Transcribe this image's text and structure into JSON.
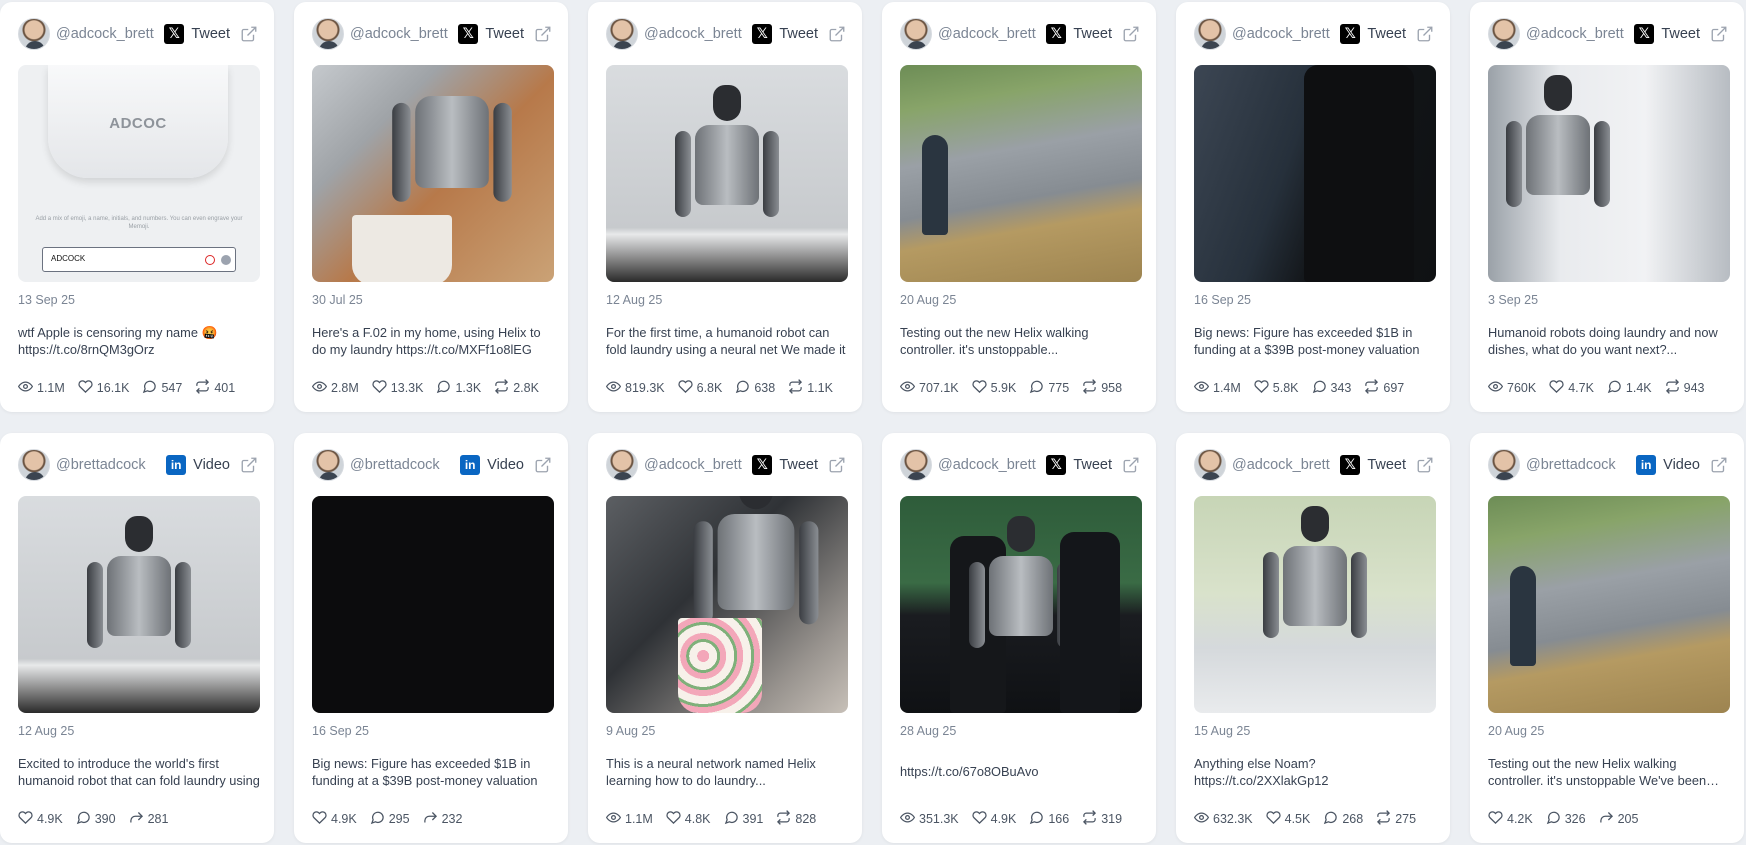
{
  "cards": [
    {
      "handle": "@adcock_brett",
      "platform": "x",
      "platform_label": "Tweet",
      "date": "13 Sep 25",
      "text": "wtf Apple is censoring my name 🤬 https://t.co/8rnQM3gOrz",
      "media": "airpods",
      "media_text": {
        "brand": "ADCOC",
        "hint": "Add a mix of emoji, a name, initials, and numbers. You can even engrave your Memoji.",
        "field": "ADCOCK"
      },
      "stats": [
        {
          "icon": "eye-icon",
          "value": "1.1M"
        },
        {
          "icon": "heart-icon",
          "value": "16.1K"
        },
        {
          "icon": "comment-icon",
          "value": "547"
        },
        {
          "icon": "retweet-icon",
          "value": "401"
        }
      ]
    },
    {
      "handle": "@adcock_brett",
      "platform": "x",
      "platform_label": "Tweet",
      "date": "30 Jul 25",
      "text": "Here's a F.02 in my home, using Helix to do my laundry https://t.co/MXFf1o8lEG",
      "media": "laundry1",
      "stats": [
        {
          "icon": "eye-icon",
          "value": "2.8M"
        },
        {
          "icon": "heart-icon",
          "value": "13.3K"
        },
        {
          "icon": "comment-icon",
          "value": "1.3K"
        },
        {
          "icon": "retweet-icon",
          "value": "2.8K"
        }
      ]
    },
    {
      "handle": "@adcock_brett",
      "platform": "x",
      "platform_label": "Tweet",
      "date": "12 Aug 25",
      "text": "For the first time, a humanoid robot can fold laundry using a neural net We made it",
      "media": "robot-grey",
      "stats": [
        {
          "icon": "eye-icon",
          "value": "819.3K"
        },
        {
          "icon": "heart-icon",
          "value": "6.8K"
        },
        {
          "icon": "comment-icon",
          "value": "638"
        },
        {
          "icon": "retweet-icon",
          "value": "1.1K"
        }
      ]
    },
    {
      "handle": "@adcock_brett",
      "platform": "x",
      "platform_label": "Tweet",
      "date": "20 Aug 25",
      "text": "Testing out the new Helix walking controller. it's unstoppable...",
      "media": "parking",
      "stats": [
        {
          "icon": "eye-icon",
          "value": "707.1K"
        },
        {
          "icon": "heart-icon",
          "value": "5.9K"
        },
        {
          "icon": "comment-icon",
          "value": "775"
        },
        {
          "icon": "retweet-icon",
          "value": "958"
        }
      ]
    },
    {
      "handle": "@adcock_brett",
      "platform": "x",
      "platform_label": "Tweet",
      "date": "16 Sep 25",
      "text": "Big news: Figure has exceeded $1B in funding at a $39B post-money valuation",
      "media": "dark-room",
      "stats": [
        {
          "icon": "eye-icon",
          "value": "1.4M"
        },
        {
          "icon": "heart-icon",
          "value": "5.8K"
        },
        {
          "icon": "comment-icon",
          "value": "343"
        },
        {
          "icon": "retweet-icon",
          "value": "697"
        }
      ]
    },
    {
      "handle": "@adcock_brett",
      "platform": "x",
      "platform_label": "Tweet",
      "date": "3 Sep 25",
      "text": "Humanoid robots doing laundry and now dishes, what do you want next?...",
      "media": "kitchen",
      "stats": [
        {
          "icon": "eye-icon",
          "value": "760K"
        },
        {
          "icon": "heart-icon",
          "value": "4.7K"
        },
        {
          "icon": "comment-icon",
          "value": "1.4K"
        },
        {
          "icon": "retweet-icon",
          "value": "943"
        }
      ]
    },
    {
      "handle": "@brettadcock",
      "platform": "linkedin",
      "platform_label": "Video",
      "date": "12 Aug 25",
      "text": "Excited to introduce the world's first humanoid robot that can fold laundry using",
      "media": "robot-grey",
      "stats": [
        {
          "icon": "heart-icon",
          "value": "4.9K"
        },
        {
          "icon": "comment-icon",
          "value": "390"
        },
        {
          "icon": "share-icon",
          "value": "281"
        }
      ]
    },
    {
      "handle": "@brettadcock",
      "platform": "linkedin",
      "platform_label": "Video",
      "date": "16 Sep 25",
      "text": "Big news: Figure has exceeded $1B in funding at a $39B post-money valuation",
      "media": "black",
      "stats": [
        {
          "icon": "heart-icon",
          "value": "4.9K"
        },
        {
          "icon": "comment-icon",
          "value": "295"
        },
        {
          "icon": "share-icon",
          "value": "232"
        }
      ]
    },
    {
      "handle": "@adcock_brett",
      "platform": "x",
      "platform_label": "Tweet",
      "date": "9 Aug 25",
      "text": "This is a neural network named Helix learning how to do laundry...",
      "media": "laundry2",
      "stats": [
        {
          "icon": "eye-icon",
          "value": "1.1M"
        },
        {
          "icon": "heart-icon",
          "value": "4.8K"
        },
        {
          "icon": "comment-icon",
          "value": "391"
        },
        {
          "icon": "retweet-icon",
          "value": "828"
        }
      ]
    },
    {
      "handle": "@adcock_brett",
      "platform": "x",
      "platform_label": "Tweet",
      "date": "28 Aug 25",
      "text": "https://t.co/67o8OBuAvo",
      "media": "meeting",
      "single": true,
      "stats": [
        {
          "icon": "eye-icon",
          "value": "351.3K"
        },
        {
          "icon": "heart-icon",
          "value": "4.9K"
        },
        {
          "icon": "comment-icon",
          "value": "166"
        },
        {
          "icon": "retweet-icon",
          "value": "319"
        }
      ]
    },
    {
      "handle": "@adcock_brett",
      "platform": "x",
      "platform_label": "Tweet",
      "date": "15 Aug 25",
      "text": "Anything else Noam? https://t.co/2XXlakGp12",
      "media": "glass",
      "stats": [
        {
          "icon": "eye-icon",
          "value": "632.3K"
        },
        {
          "icon": "heart-icon",
          "value": "4.5K"
        },
        {
          "icon": "comment-icon",
          "value": "268"
        },
        {
          "icon": "retweet-icon",
          "value": "275"
        }
      ]
    },
    {
      "handle": "@brettadcock",
      "platform": "linkedin",
      "platform_label": "Video",
      "date": "20 Aug 25",
      "text": "Testing out the new Helix walking controller. it's unstoppable We've been working",
      "media": "parking",
      "stats": [
        {
          "icon": "heart-icon",
          "value": "4.2K"
        },
        {
          "icon": "comment-icon",
          "value": "326"
        },
        {
          "icon": "share-icon",
          "value": "205"
        }
      ]
    }
  ]
}
